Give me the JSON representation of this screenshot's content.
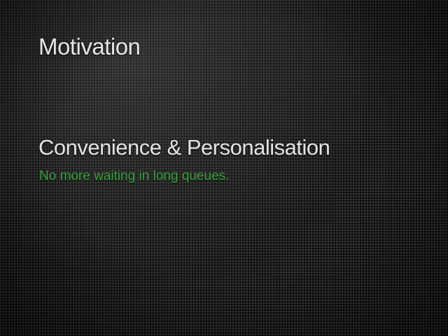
{
  "slide": {
    "title": "Motivation",
    "heading": "Convenience & Personalisation",
    "subline": "No more waiting in long queues."
  },
  "colors": {
    "background": "#1a1a1a",
    "title_text": "#e6e6e6",
    "accent_green": "#3aa33f"
  }
}
